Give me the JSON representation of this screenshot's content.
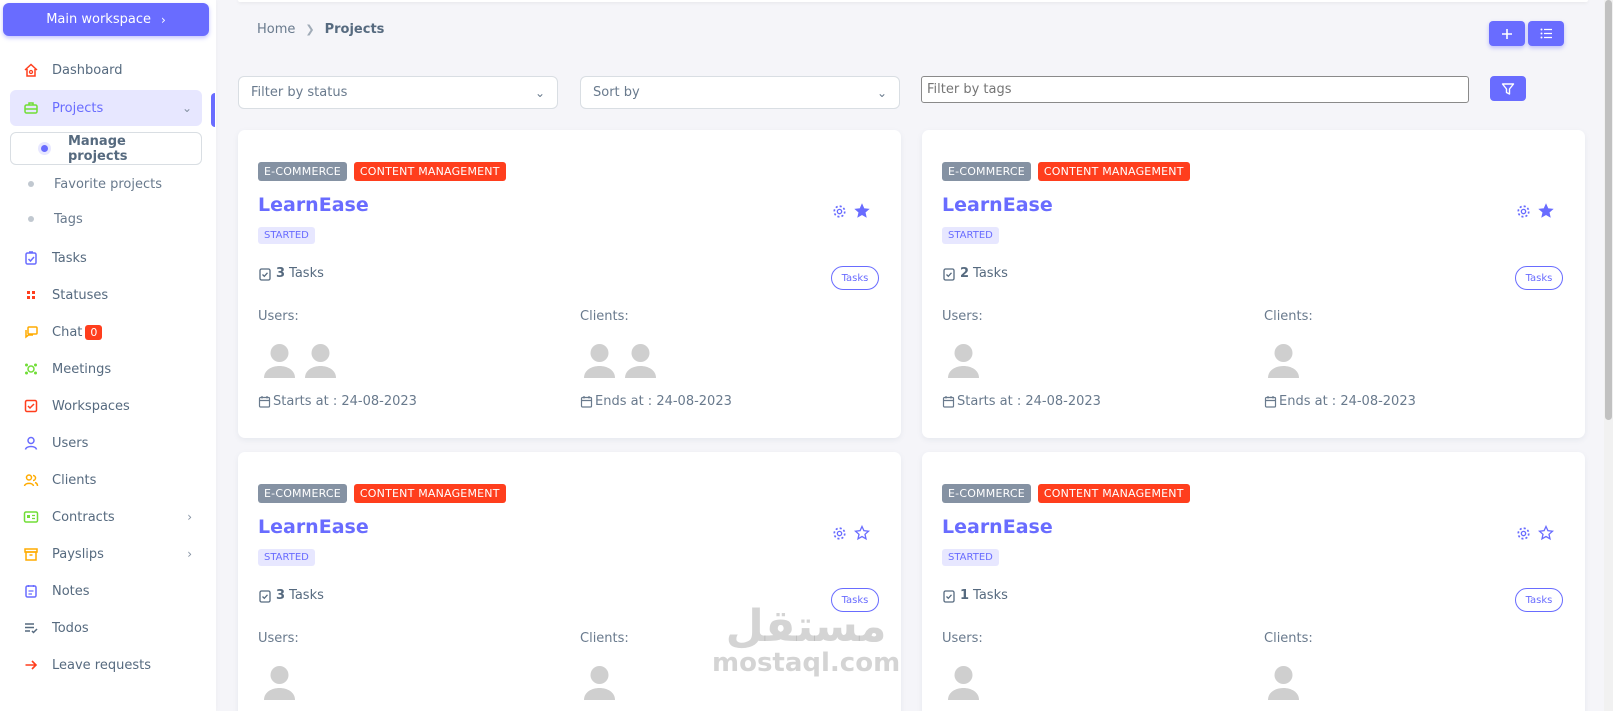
{
  "sidebar": {
    "workspace_button": "Main workspace",
    "items": [
      {
        "label": "Dashboard",
        "icon": "home-icon",
        "color": "#ff3e1d"
      },
      {
        "label": "Projects",
        "icon": "briefcase-icon",
        "color": "#71dd37"
      },
      {
        "label": "Tasks",
        "icon": "task-icon",
        "color": "#696cff"
      },
      {
        "label": "Statuses",
        "icon": "grid-icon",
        "color": "#ff3e1d"
      },
      {
        "label": "Chat",
        "icon": "chat-icon",
        "color": "#ffab00",
        "badge": "0"
      },
      {
        "label": "Meetings",
        "icon": "meeting-icon",
        "color": "#71dd37"
      },
      {
        "label": "Workspaces",
        "icon": "check-square-icon",
        "color": "#ff3e1d"
      },
      {
        "label": "Users",
        "icon": "user-icon",
        "color": "#696cff"
      },
      {
        "label": "Clients",
        "icon": "users-icon",
        "color": "#ffab00"
      },
      {
        "label": "Contracts",
        "icon": "id-card-icon",
        "color": "#71dd37"
      },
      {
        "label": "Payslips",
        "icon": "archive-icon",
        "color": "#ffab00"
      },
      {
        "label": "Notes",
        "icon": "notes-icon",
        "color": "#696cff"
      },
      {
        "label": "Todos",
        "icon": "list-check-icon",
        "color": "#566a7f"
      },
      {
        "label": "Leave requests",
        "icon": "arrow-right-icon",
        "color": "#ff3e1d"
      }
    ],
    "project_sub": [
      "Manage projects",
      "Favorite projects",
      "Tags"
    ]
  },
  "breadcrumb": {
    "home": "Home",
    "current": "Projects"
  },
  "filters": {
    "status_placeholder": "Filter by status",
    "sort_placeholder": "Sort by",
    "tags_placeholder": "Filter by tags"
  },
  "accent": "#696cff",
  "projects": [
    {
      "tags": [
        "E-COMMERCE",
        "CONTENT MANAGEMENT"
      ],
      "title": "LearnEase",
      "status": "STARTED",
      "task_count": "3",
      "tasks_word": "Tasks",
      "tasks_button": "Tasks",
      "users_label": "Users:",
      "clients_label": "Clients:",
      "users": 2,
      "clients": 2,
      "favorite": true,
      "start": "Starts at : 24-08-2023",
      "end": "Ends at : 24-08-2023"
    },
    {
      "tags": [
        "E-COMMERCE",
        "CONTENT MANAGEMENT"
      ],
      "title": "LearnEase",
      "status": "STARTED",
      "task_count": "2",
      "tasks_word": "Tasks",
      "tasks_button": "Tasks",
      "users_label": "Users:",
      "clients_label": "Clients:",
      "users": 1,
      "clients": 1,
      "favorite": true,
      "start": "Starts at : 24-08-2023",
      "end": "Ends at : 24-08-2023"
    },
    {
      "tags": [
        "E-COMMERCE",
        "CONTENT MANAGEMENT"
      ],
      "title": "LearnEase",
      "status": "STARTED",
      "task_count": "3",
      "tasks_word": "Tasks",
      "tasks_button": "Tasks",
      "users_label": "Users:",
      "clients_label": "Clients:",
      "users": 1,
      "clients": 1,
      "favorite": false
    },
    {
      "tags": [
        "E-COMMERCE",
        "CONTENT MANAGEMENT"
      ],
      "title": "LearnEase",
      "status": "STARTED",
      "task_count": "1",
      "tasks_word": "Tasks",
      "tasks_button": "Tasks",
      "users_label": "Users:",
      "clients_label": "Clients:",
      "users": 1,
      "clients": 1,
      "favorite": false
    }
  ],
  "watermark": {
    "arabic": "مستقل",
    "latin": "mostaql.com"
  }
}
